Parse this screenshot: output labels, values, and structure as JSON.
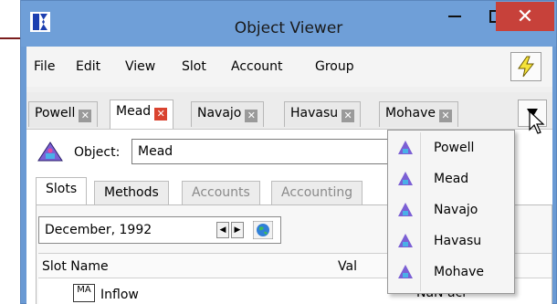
{
  "window": {
    "title": "Object Viewer",
    "close_glyph": "✕"
  },
  "menu": {
    "items": [
      "File",
      "Edit",
      "View",
      "Slot",
      "Account",
      "Group"
    ]
  },
  "doc_tabs": [
    {
      "label": "Powell",
      "active": false
    },
    {
      "label": "Mead",
      "active": true
    },
    {
      "label": "Navajo",
      "active": false
    },
    {
      "label": "Havasu",
      "active": false
    },
    {
      "label": "Mohave",
      "active": false
    }
  ],
  "object": {
    "label": "Object:",
    "value": "Mead"
  },
  "sub_tabs": [
    {
      "label": "Slots",
      "active": true,
      "dim": false
    },
    {
      "label": "Methods",
      "active": false,
      "dim": false
    },
    {
      "label": "Accounts",
      "active": false,
      "dim": true
    },
    {
      "label": "Accounting",
      "active": false,
      "dim": true
    }
  ],
  "timestep": {
    "value": "December, 1992"
  },
  "grid": {
    "columns": {
      "slot_name": "Slot Name",
      "value": "Val"
    },
    "rows": [
      {
        "icon_text": "MA",
        "name": "Inflow",
        "value": "NaN   acr"
      }
    ]
  },
  "popup": {
    "items": [
      "Powell",
      "Mead",
      "Navajo",
      "Havasu",
      "Mohave"
    ]
  },
  "colors": {
    "titlebar": "#6f9fd8",
    "close": "#c7413a",
    "tab_close_active": "#d9432f"
  }
}
